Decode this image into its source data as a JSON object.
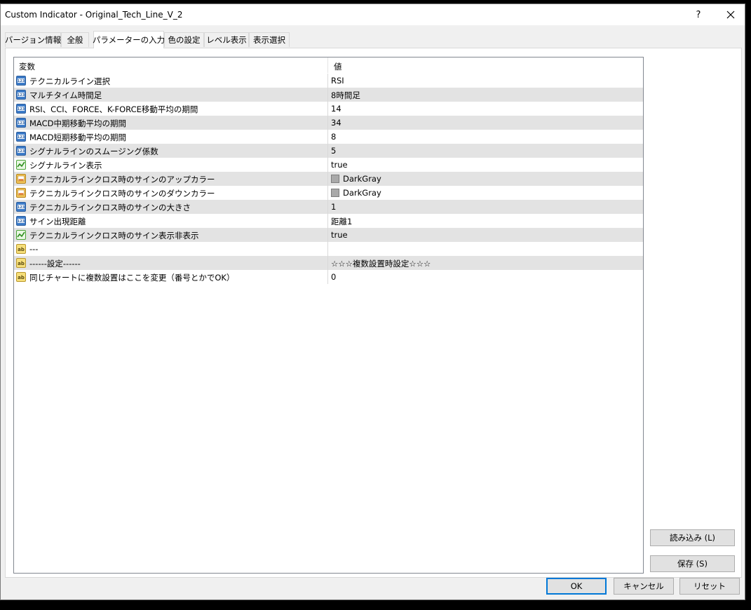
{
  "window": {
    "title": "Custom Indicator - Original_Tech_Line_V_2",
    "help_label": "?"
  },
  "tabs": [
    {
      "label": "バージョン情報"
    },
    {
      "label": "全般"
    },
    {
      "label": "パラメーターの入力"
    },
    {
      "label": "色の設定"
    },
    {
      "label": "レベル表示"
    },
    {
      "label": "表示選択"
    }
  ],
  "active_tab": "パラメーターの入力",
  "table": {
    "columns": {
      "name": "変数",
      "value": "値"
    },
    "rows": [
      {
        "icon": "int",
        "name": "テクニカルライン選択",
        "value": "RSI"
      },
      {
        "icon": "int",
        "name": "マルチタイム時間足",
        "value": "8時間足"
      },
      {
        "icon": "int",
        "name": "RSI、CCI、FORCE、K-FORCE移動平均の期間",
        "value": "14"
      },
      {
        "icon": "int",
        "name": "MACD中期移動平均の期間",
        "value": "34"
      },
      {
        "icon": "int",
        "name": "MACD短期移動平均の期間",
        "value": "8"
      },
      {
        "icon": "int",
        "name": "シグナルラインのスムージング係数",
        "value": "5"
      },
      {
        "icon": "bool",
        "name": "シグナルライン表示",
        "value": "true"
      },
      {
        "icon": "color",
        "name": "テクニカルラインクロス時のサインのアップカラー",
        "value": "DarkGray",
        "swatch": "#a9a9a9"
      },
      {
        "icon": "color",
        "name": "テクニカルラインクロス時のサインのダウンカラー",
        "value": "DarkGray",
        "swatch": "#a9a9a9"
      },
      {
        "icon": "int",
        "name": "テクニカルラインクロス時のサインの大きさ",
        "value": "1"
      },
      {
        "icon": "int",
        "name": "サイン出現距離",
        "value": "距離1"
      },
      {
        "icon": "bool",
        "name": "テクニカルラインクロス時のサイン表示非表示",
        "value": "true"
      },
      {
        "icon": "string",
        "name": "---",
        "value": ""
      },
      {
        "icon": "string",
        "name": "------設定------",
        "value": "☆☆☆複数設置時設定☆☆☆"
      },
      {
        "icon": "string",
        "name": "同じチャートに複数設置はここを変更（番号とかでOK）",
        "value": "0"
      }
    ]
  },
  "side_buttons": {
    "load": "読み込み (L)",
    "save": "保存 (S)"
  },
  "bottom_buttons": {
    "ok": "OK",
    "cancel": "キャンセル",
    "reset": "リセット"
  },
  "colors": {
    "accent": "#0078d7",
    "alt_row": "#e3e3e3"
  }
}
